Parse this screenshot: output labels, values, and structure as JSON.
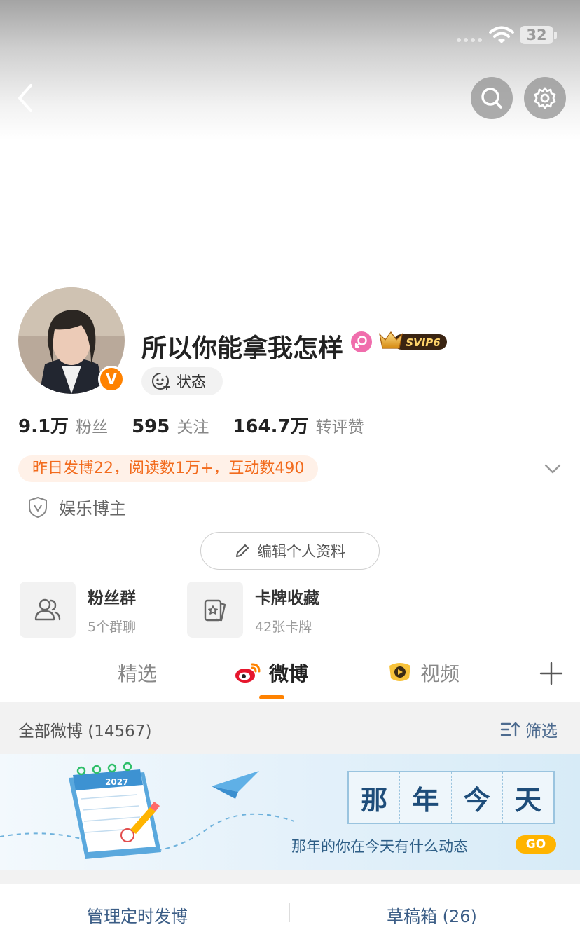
{
  "status_bar": {
    "battery": "32"
  },
  "profile": {
    "username": "所以你能拿我怎样",
    "svip_label": "SVIP6",
    "status_chip": "状态",
    "verified_badge": "V",
    "stats": [
      {
        "value": "9.1万",
        "label": "粉丝"
      },
      {
        "value": "595",
        "label": "关注"
      },
      {
        "value": "164.7万",
        "label": "转评赞"
      }
    ],
    "activity": "昨日发博22，阅读数1万+，互动数490",
    "category": "娱乐博主",
    "edit_button": "编辑个人资料"
  },
  "cards": [
    {
      "title": "粉丝群",
      "subtitle": "5个群聊"
    },
    {
      "title": "卡牌收藏",
      "subtitle": "42张卡牌"
    }
  ],
  "tabs": [
    {
      "label": "精选"
    },
    {
      "label": "微博"
    },
    {
      "label": "视频"
    }
  ],
  "filter_bar": {
    "title": "全部微博 (14567)",
    "filter_label": "筛选"
  },
  "banner": {
    "calendar_year": "2027",
    "title_chars": [
      "那",
      "年",
      "今",
      "天"
    ],
    "subtitle": "那年的你在今天有什么动态",
    "go_label": "GO"
  },
  "bottom": {
    "scheduled": "管理定时发博",
    "drafts": "草稿箱 (26)"
  },
  "colors": {
    "accent": "#ff8200",
    "link": "#3b5d86",
    "activity_text": "#f26b1d",
    "activity_bg": "#fff1e8"
  }
}
